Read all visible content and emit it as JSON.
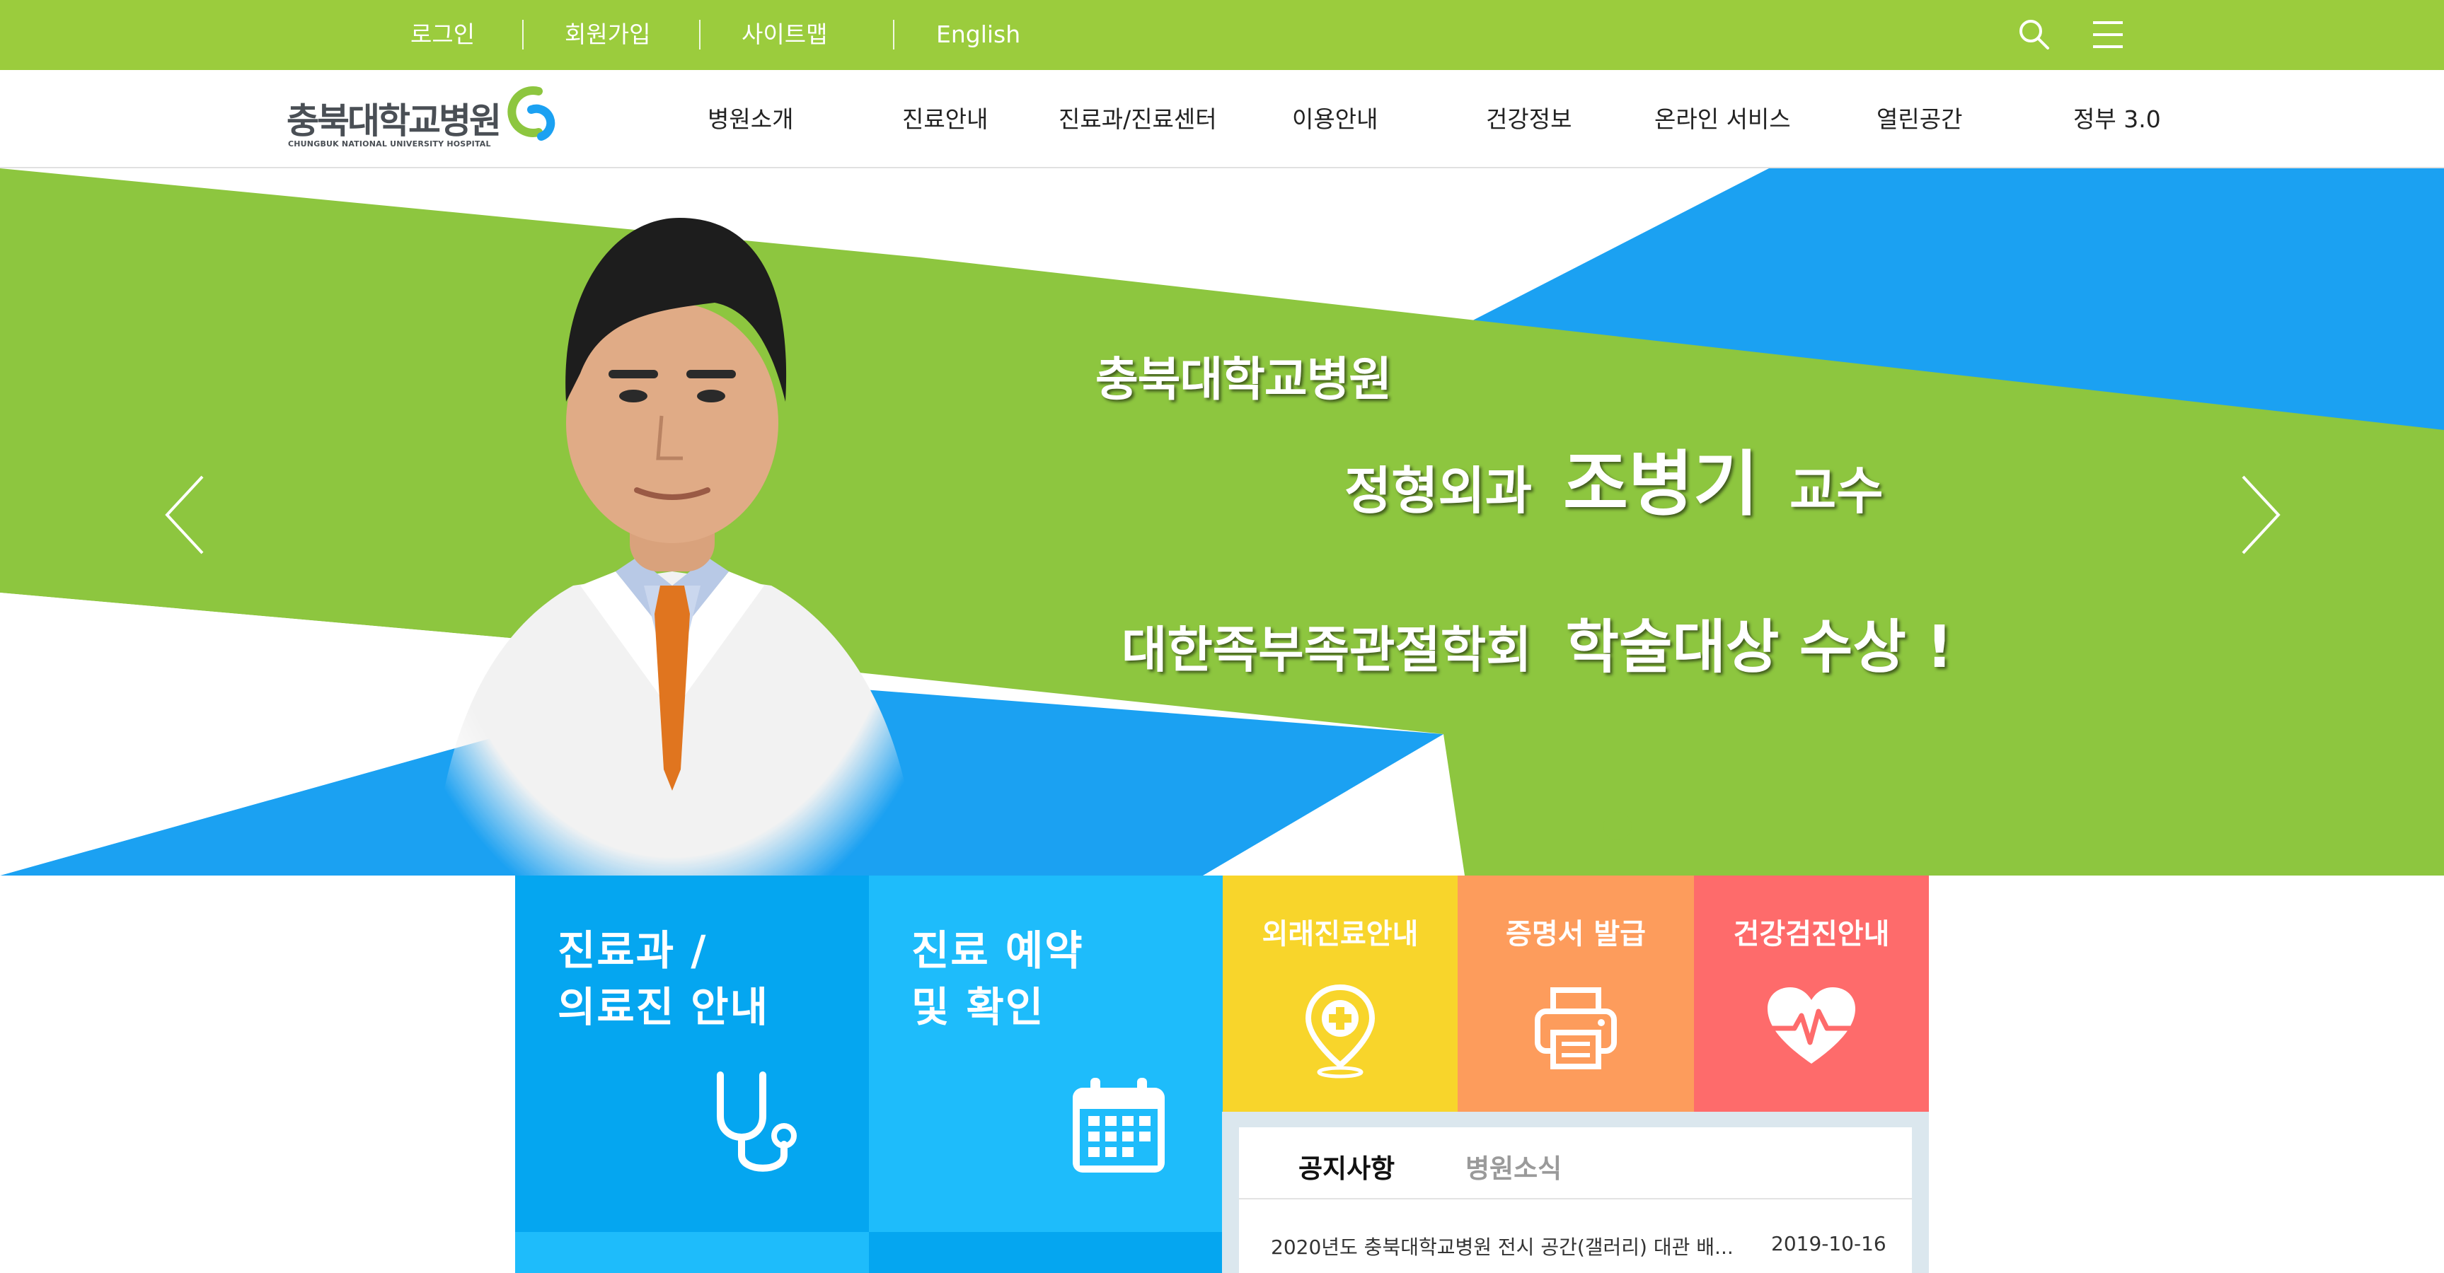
{
  "util_bar": {
    "links": [
      "로그인",
      "회원가입",
      "사이트맵",
      "English"
    ],
    "search_icon": "search-icon",
    "menu_icon": "hamburger-menu-icon",
    "bg_color": "#9bcc3d"
  },
  "header": {
    "logo_text": "충북대학교병원",
    "logo_sub": "CHUNGBUK NATIONAL UNIVERSITY HOSPITAL",
    "nav": [
      "병원소개",
      "진료안내",
      "진료과/진료센터",
      "이용안내",
      "건강정보",
      "온라인 서비스",
      "열린공간",
      "정부 3.0"
    ]
  },
  "hero": {
    "line1": "충북대학교병원",
    "line2_dept": "정형외과",
    "line2_name": "조병기",
    "line2_title": "교수",
    "line3_society": "대한족부족관절학회",
    "line3_award": "학술대상 수상 !",
    "prev_icon": "chevron-left-icon",
    "next_icon": "chevron-right-icon",
    "colors": {
      "green": "#8dc63f",
      "blue": "#1ba1f2"
    }
  },
  "tiles": {
    "departments": {
      "line1": "진료과 /",
      "line2": "의료진 안내",
      "icon": "stethoscope-icon",
      "color": "#05a6f0"
    },
    "reservation": {
      "line1": "진료 예약",
      "line2": "및 확인",
      "icon": "calendar-icon",
      "color": "#1ebcfb"
    },
    "outpatient": {
      "label": "외래진료안내",
      "icon": "location-pin-icon",
      "color": "#f8d52b"
    },
    "certificate": {
      "label": "증명서 발급",
      "icon": "printer-icon",
      "color": "#fd9c5c"
    },
    "checkup": {
      "label": "건강검진안내",
      "icon": "heart-pulse-icon",
      "color": "#fe6b6b"
    }
  },
  "notice": {
    "tabs": [
      "공지사항",
      "병원소식"
    ],
    "items": [
      {
        "title": "2020년도 충북대학교병원 전시 공간(갤러리) 대관 배...",
        "date": "2019-10-16"
      }
    ]
  }
}
